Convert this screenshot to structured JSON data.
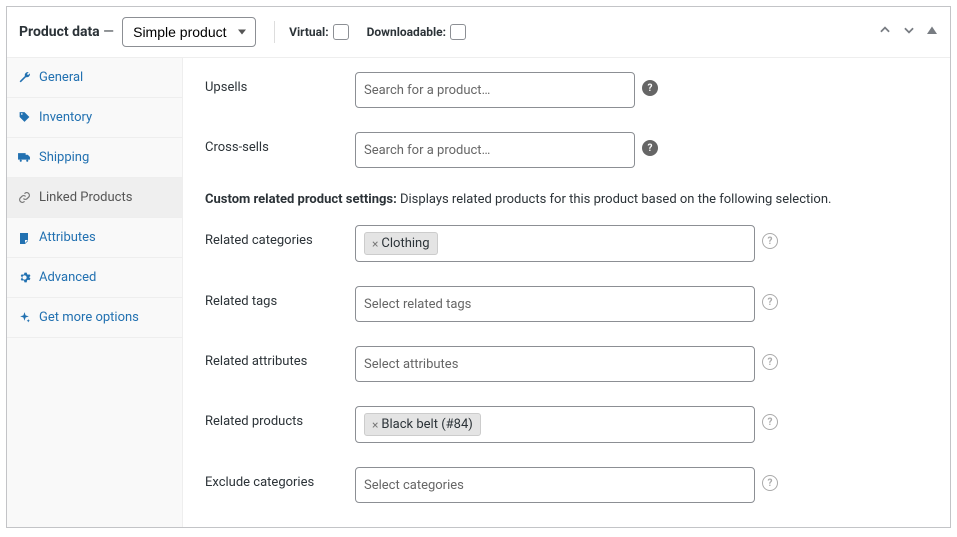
{
  "header": {
    "title": "Product data",
    "dash": "—",
    "product_type": "Simple product",
    "virtual_label": "Virtual:",
    "downloadable_label": "Downloadable:"
  },
  "tabs": [
    {
      "label": "General",
      "icon": "wrench"
    },
    {
      "label": "Inventory",
      "icon": "tag"
    },
    {
      "label": "Shipping",
      "icon": "truck"
    },
    {
      "label": "Linked Products",
      "icon": "link",
      "active": true
    },
    {
      "label": "Attributes",
      "icon": "note"
    },
    {
      "label": "Advanced",
      "icon": "gear"
    },
    {
      "label": "Get more options",
      "icon": "sparkle"
    }
  ],
  "fields": {
    "upsells": {
      "label": "Upsells",
      "placeholder": "Search for a product…"
    },
    "cross": {
      "label": "Cross-sells",
      "placeholder": "Search for a product…"
    },
    "desc_bold": "Custom related product settings:",
    "desc_rest": " Displays related products for this product based on the following selection.",
    "rel_cat": {
      "label": "Related categories",
      "tags": [
        "Clothing"
      ]
    },
    "rel_tags": {
      "label": "Related tags",
      "placeholder": "Select related tags"
    },
    "rel_attr": {
      "label": "Related attributes",
      "placeholder": "Select attributes"
    },
    "rel_prod": {
      "label": "Related products",
      "tags": [
        "Black belt (#84)"
      ]
    },
    "excl_cat": {
      "label": "Exclude categories",
      "placeholder": "Select categories"
    }
  }
}
